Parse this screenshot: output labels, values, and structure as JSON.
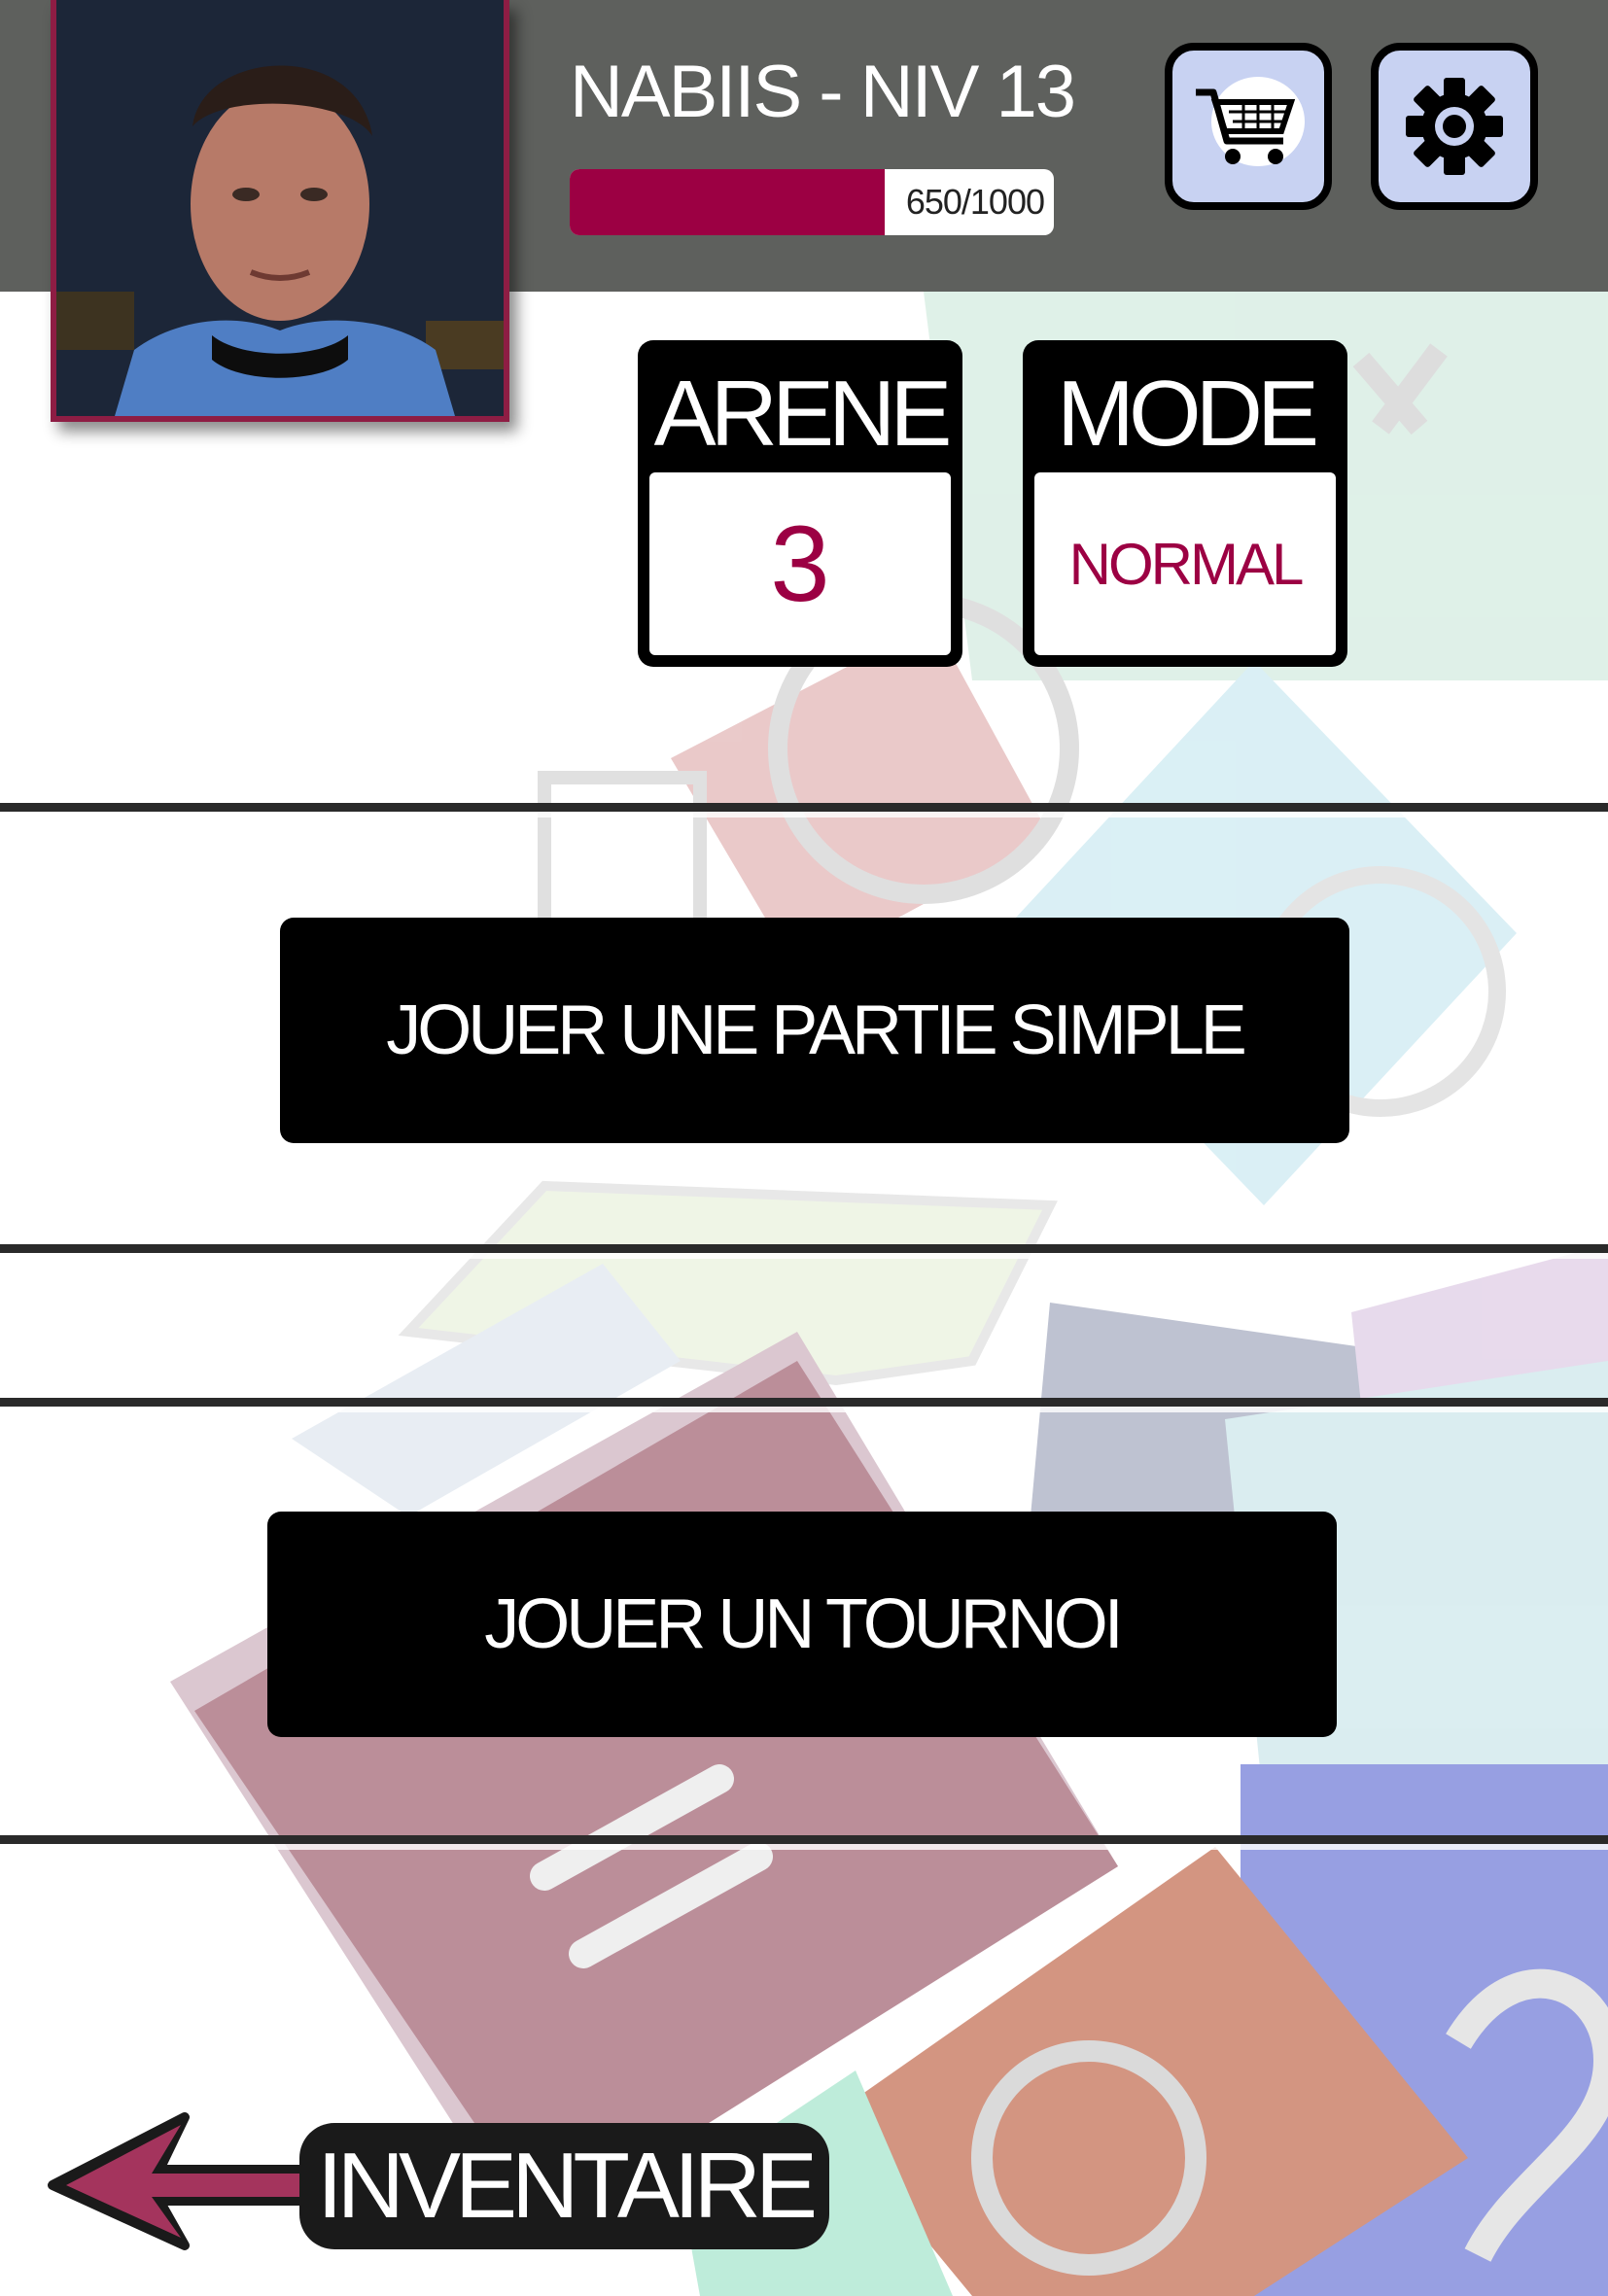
{
  "header": {
    "player_name": "NABIIS - NIV 13",
    "xp_current": 650,
    "xp_max": 1000,
    "xp_text": "650/1000"
  },
  "avatar": {
    "icon": "player-portrait"
  },
  "shop_button": {
    "icon": "shopping-cart-icon"
  },
  "settings_button": {
    "icon": "gear-icon"
  },
  "arena_card": {
    "title": "ARENE",
    "value": "3"
  },
  "mode_card": {
    "title": "MODE",
    "value": "NORMAL"
  },
  "buttons": {
    "simple_game": "JOUER UNE PARTIE SIMPLE",
    "tournament": "JOUER UN TOURNOI"
  },
  "inventory": {
    "label": "INVENTAIRE",
    "icon": "arrow-left-icon"
  },
  "colors": {
    "header_bg": "#5e605d",
    "accent": "#9c0043",
    "button_bg": "#000000",
    "icon_button_bg": "#c8d2f2"
  }
}
